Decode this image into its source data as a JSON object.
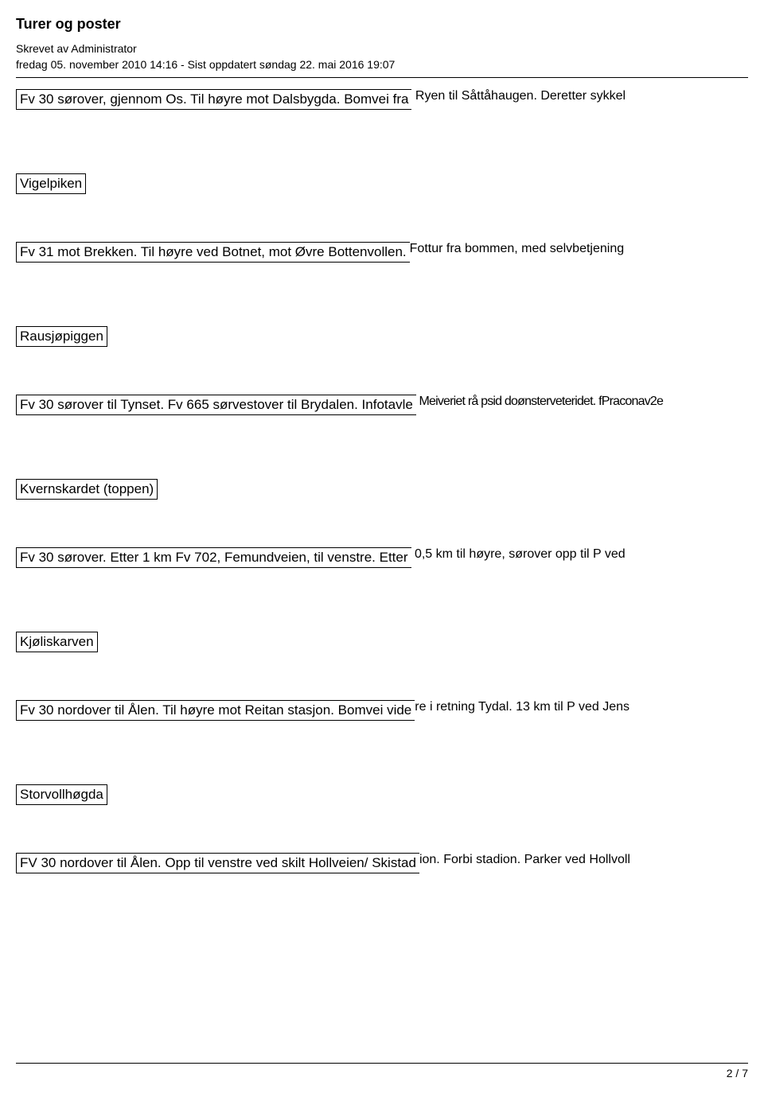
{
  "header": {
    "title": "Turer og poster",
    "author_line": "Skrevet av Administrator",
    "date_line": "fredag 05. november 2010 14:16 - Sist oppdatert søndag 22. mai 2016 19:07"
  },
  "rows": [
    {
      "main": "Fv 30 sørover, gjennom Os. Til høyre mot Dalsbygda. Bomvei fra",
      "trail": " Ryen  til Såttåhaugen. Deretter sykkel"
    },
    {
      "main": "Vigelpiken"
    },
    {
      "main": "Fv 31 mot Brekken. Til høyre ved Botnet, mot Øvre Bottenvollen. ",
      "trail": "Fottur fra bommen, med selvbetjening"
    },
    {
      "main": "Rausjøpiggen"
    },
    {
      "main": "Fv 30 sørover til Tynset. Fv 665 sørvestover til Brydalen. Infotavle",
      "trail": " Meiveriet rå psid doønsterveteridet. fPraconav2e",
      "jammed": true
    },
    {
      "main": "Kvernskardet (toppen)"
    },
    {
      "main": "Fv 30 sørover. Etter 1 km Fv 702, Femundveien, til venstre. Etter",
      "trail": " 0,5 km til høyre, sørover opp til P ved"
    },
    {
      "main": "Kjøliskarven"
    },
    {
      "main": "Fv 30 nordover til Ålen. Til høyre mot Reitan stasjon. Bomvei vide",
      "trail": "re i retning Tydal. 13 km til P ved Jens"
    },
    {
      "main": "Storvollhøgda"
    },
    {
      "main": "FV 30 nordover til Ålen. Opp til venstre ved skilt Hollveien/ Skistad",
      "trail": "ion. Forbi stadion. Parker ved Hollvoll"
    }
  ],
  "footer": {
    "page": "2 / 7"
  }
}
